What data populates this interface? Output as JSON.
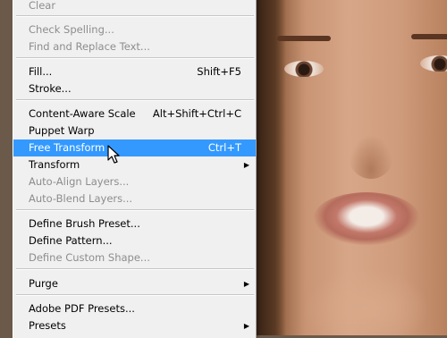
{
  "menu": {
    "items": [
      {
        "label": "Clear",
        "shortcut": "",
        "disabled": true
      },
      {
        "label": "Check Spelling...",
        "shortcut": "",
        "disabled": true
      },
      {
        "label": "Find and Replace Text...",
        "shortcut": "",
        "disabled": true
      },
      {
        "label": "Fill...",
        "shortcut": "Shift+F5",
        "disabled": false
      },
      {
        "label": "Stroke...",
        "shortcut": "",
        "disabled": false
      },
      {
        "label": "Content-Aware Scale",
        "shortcut": "Alt+Shift+Ctrl+C",
        "disabled": false
      },
      {
        "label": "Puppet Warp",
        "shortcut": "",
        "disabled": false
      },
      {
        "label": "Free Transform",
        "shortcut": "Ctrl+T",
        "disabled": false,
        "highlighted": true
      },
      {
        "label": "Transform",
        "shortcut": "",
        "disabled": false,
        "submenu": true
      },
      {
        "label": "Auto-Align Layers...",
        "shortcut": "",
        "disabled": true
      },
      {
        "label": "Auto-Blend Layers...",
        "shortcut": "",
        "disabled": true
      },
      {
        "label": "Define Brush Preset...",
        "shortcut": "",
        "disabled": false
      },
      {
        "label": "Define Pattern...",
        "shortcut": "",
        "disabled": false
      },
      {
        "label": "Define Custom Shape...",
        "shortcut": "",
        "disabled": true
      },
      {
        "label": "Purge",
        "shortcut": "",
        "disabled": false,
        "submenu": true
      },
      {
        "label": "Adobe PDF Presets...",
        "shortcut": "",
        "disabled": false
      },
      {
        "label": "Presets",
        "shortcut": "",
        "disabled": false,
        "submenu": true
      }
    ],
    "submenu_arrow": "▶"
  },
  "colors": {
    "menu_bg": "#f0f0f0",
    "highlight": "#3399ff",
    "disabled_text": "#8d8d8d"
  },
  "icons": {
    "cursor": "mouse-pointer-icon"
  }
}
